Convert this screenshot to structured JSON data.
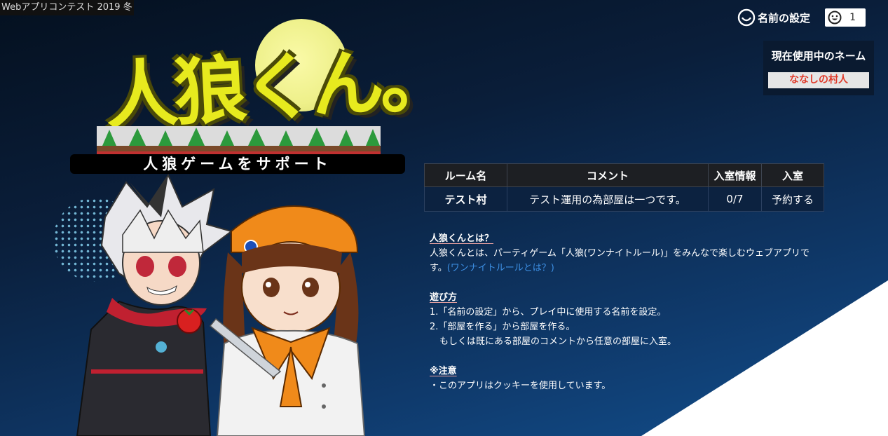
{
  "contest_label": "Webアプリコンテスト 2019 冬",
  "header": {
    "name_setting_label": "名前の設定",
    "smile_icon": "smile-icon",
    "member_count": "1"
  },
  "current_name": {
    "title": "現在使用中のネーム",
    "value": "ななしの村人"
  },
  "logo": {
    "title": "人狼くん。",
    "subtitle": "人狼ゲームをサポート"
  },
  "rooms": {
    "headers": [
      "ルーム名",
      "コメント",
      "入室情報",
      "入室"
    ],
    "rows": [
      {
        "name": "テスト村",
        "comment": "テスト運用の為部屋は一つです。",
        "info": "0/7",
        "enter": "予約する"
      }
    ]
  },
  "about": {
    "heading": "人狼くんとは？",
    "text": "人狼くんとは、パーティゲーム「人狼(ワンナイトルール)」をみんなで楽しむウェブアプリです。",
    "link": "(ワンナイトルールとは？)"
  },
  "howto": {
    "heading": "遊び方",
    "steps": [
      "1.「名前の設定」から、プレイ中に使用する名前を設定。",
      "2.「部屋を作る」から部屋を作る。",
      "もしくは既にある部屋のコメントから任意の部屋に入室。"
    ]
  },
  "notice": {
    "heading": "※注意",
    "text": "・このアプリはクッキーを使用しています。"
  },
  "colors": {
    "accent_name": "#e03a2a",
    "link": "#3d8fe3",
    "logo_yellow": "#e7ea1e"
  }
}
